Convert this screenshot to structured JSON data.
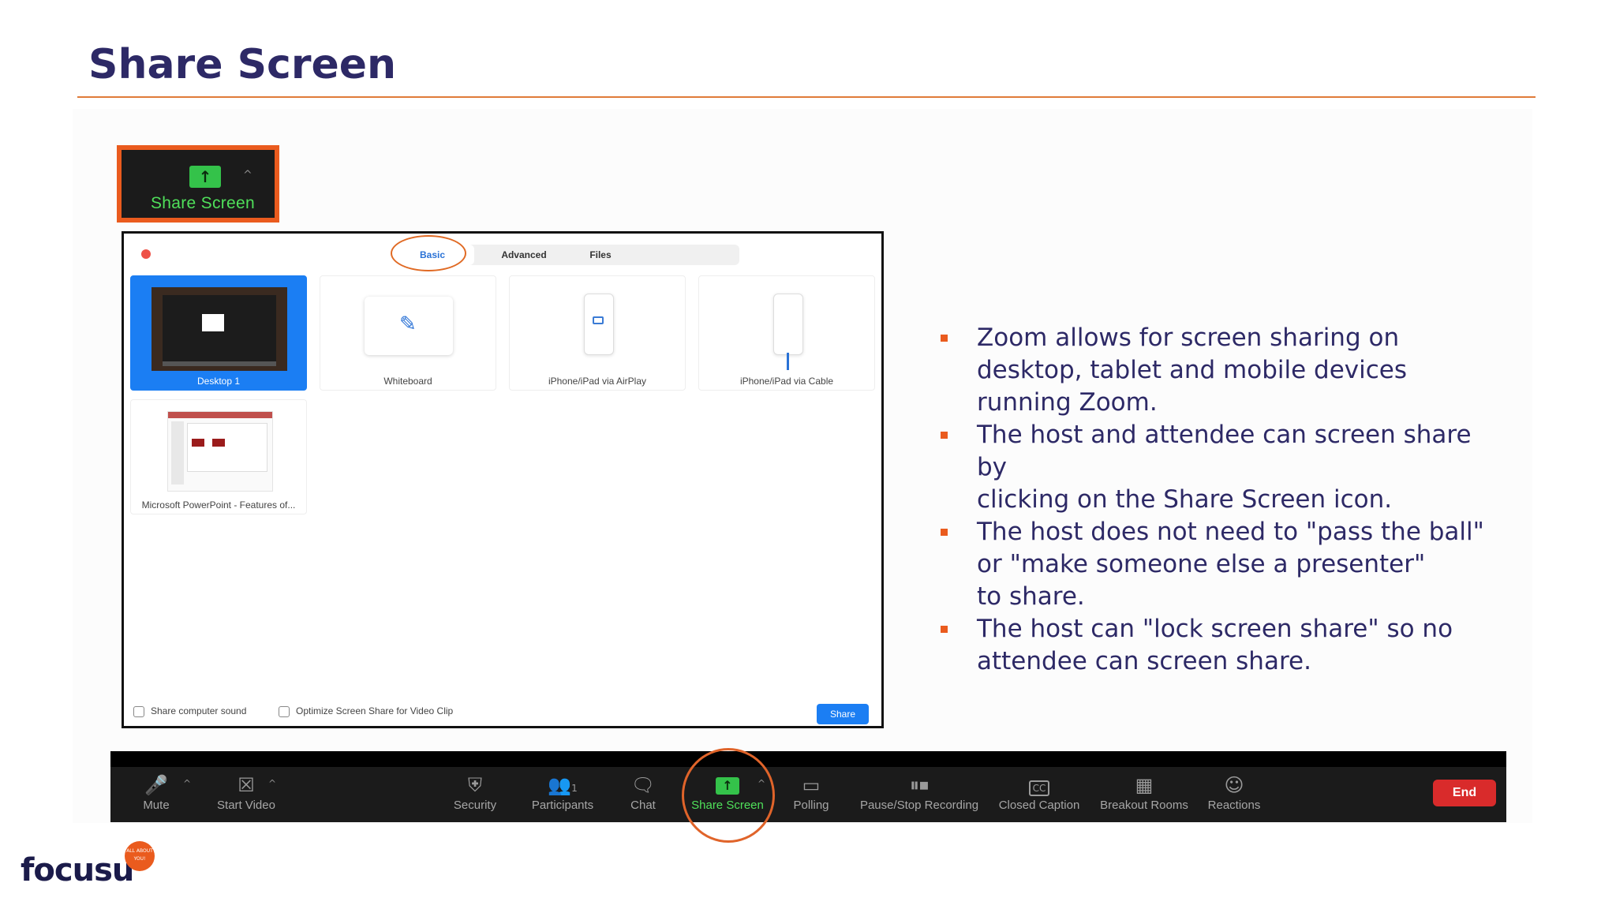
{
  "slide": {
    "title": "Share Screen"
  },
  "highlight_button": {
    "label": "Share Screen",
    "icon": "up-arrow-icon"
  },
  "dialog": {
    "tabs": [
      {
        "label": "Basic"
      },
      {
        "label": "Advanced"
      },
      {
        "label": "Files"
      }
    ],
    "tiles": [
      {
        "label": "Desktop 1"
      },
      {
        "label": "Whiteboard"
      },
      {
        "label": "iPhone/iPad via AirPlay"
      },
      {
        "label": "iPhone/iPad via Cable"
      },
      {
        "label": "Microsoft PowerPoint - Features of..."
      }
    ],
    "options": [
      {
        "label": "Share computer sound"
      },
      {
        "label": "Optimize Screen Share for Video Clip"
      }
    ],
    "share_label": "Share"
  },
  "bullets": [
    {
      "text": "Zoom allows for screen sharing on\ndesktop, tablet and mobile devices\nrunning Zoom."
    },
    {
      "text": "The host and attendee can screen share by\nclicking on the Share Screen icon."
    },
    {
      "text": "The host does not need to \"pass the ball\"\nor \"make someone else a presenter\"\nto share."
    },
    {
      "text": "The host can \"lock screen share\" so no\nattendee can screen share."
    }
  ],
  "toolbar": {
    "items": [
      {
        "label": "Mute",
        "icon": "microphone-icon"
      },
      {
        "label": "Start Video",
        "icon": "video-off-icon"
      },
      {
        "label": "Security",
        "icon": "shield-icon"
      },
      {
        "label": "Participants",
        "icon": "participants-icon",
        "count": "1"
      },
      {
        "label": "Chat",
        "icon": "chat-icon"
      },
      {
        "label": "Share Screen",
        "icon": "share-screen-icon"
      },
      {
        "label": "Polling",
        "icon": "polling-icon"
      },
      {
        "label": "Pause/Stop Recording",
        "icon": "pause-stop-icon"
      },
      {
        "label": "Closed Caption",
        "icon": "cc-icon"
      },
      {
        "label": "Breakout Rooms",
        "icon": "breakout-rooms-icon"
      },
      {
        "label": "Reactions",
        "icon": "reactions-icon"
      }
    ],
    "end_label": "End"
  },
  "brand": {
    "logo_text": "focusu",
    "badge_text": "ALL ABOUT YOU!",
    "accent": "#ea5b1e",
    "title_color": "#2d2966"
  }
}
